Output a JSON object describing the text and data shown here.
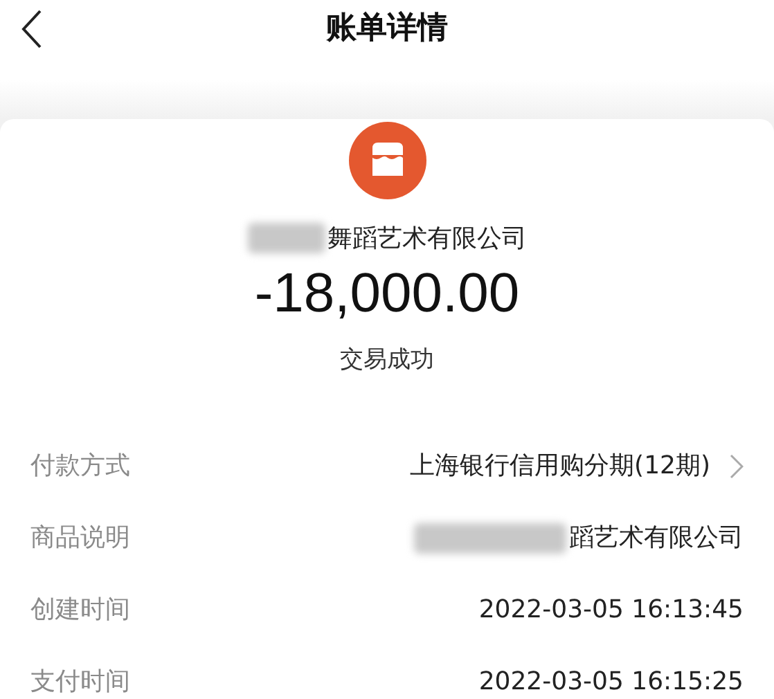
{
  "header": {
    "title": "账单详情"
  },
  "merchant": {
    "name": "舞蹈艺术有限公司",
    "redacted": true
  },
  "amount": "-18,000.00",
  "status": "交易成功",
  "rows": [
    {
      "label": "付款方式",
      "value": "上海银行信用购分期(12期)",
      "redacted": false,
      "has_chevron": true
    },
    {
      "label": "商品说明",
      "value": "蹈艺术有限公司",
      "redacted": true,
      "has_chevron": false
    },
    {
      "label": "创建时间",
      "value": "2022-03-05 16:13:45",
      "redacted": false,
      "has_chevron": false
    },
    {
      "label": "支付时间",
      "value": "2022-03-05 16:15:25",
      "redacted": false,
      "has_chevron": false
    }
  ]
}
